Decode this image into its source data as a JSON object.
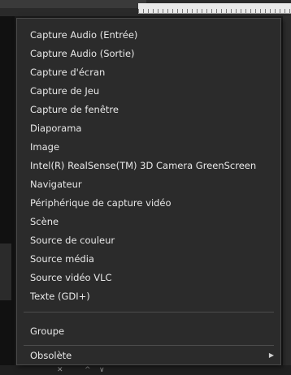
{
  "menu": {
    "items": [
      {
        "label": "Capture Audio (Entrée)"
      },
      {
        "label": "Capture Audio (Sortie)"
      },
      {
        "label": "Capture d'écran"
      },
      {
        "label": "Capture de Jeu"
      },
      {
        "label": "Capture de fenêtre"
      },
      {
        "label": "Diaporama"
      },
      {
        "label": "Image"
      },
      {
        "label": "Intel(R) RealSense(TM) 3D Camera GreenScreen"
      },
      {
        "label": "Navigateur"
      },
      {
        "label": "Périphérique de capture vidéo"
      },
      {
        "label": "Scène"
      },
      {
        "label": "Source de couleur"
      },
      {
        "label": "Source média"
      },
      {
        "label": "Source vidéo VLC"
      },
      {
        "label": "Texte (GDI+)"
      }
    ],
    "group_label": "Groupe",
    "obsolete_label": "Obsolète",
    "submenu_arrow": "▶"
  },
  "background": {
    "bottom_glyphs": [
      "✕",
      "^",
      "∨"
    ]
  },
  "colors": {
    "menu_background": "#2b2b2b",
    "menu_text": "#e8e8e8",
    "separator": "#4d4d4d",
    "hover": "#3d3d3d"
  }
}
